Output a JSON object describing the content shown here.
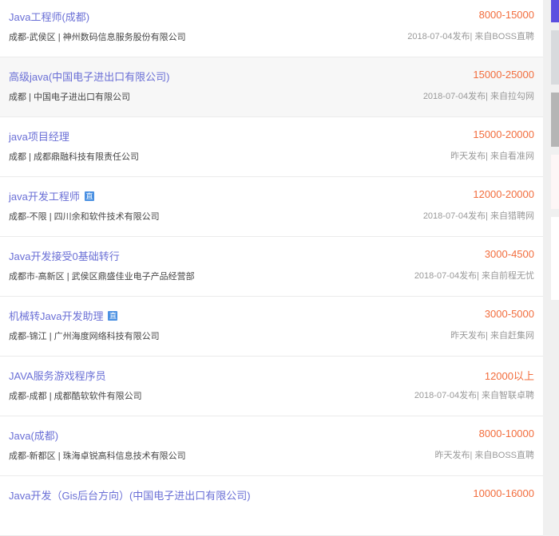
{
  "jobs": [
    {
      "title": "Java工程师(成都)",
      "badge": "",
      "location": "成都-武侯区 | ",
      "company": "神州数码信息服务股份有限公司",
      "salary": "8000-15000",
      "posted": "2018-07-04发布| 来自BOSS直聘"
    },
    {
      "title": "高级java(中国电子进出口有限公司)",
      "badge": "",
      "location": "成都 | ",
      "company": "中国电子进出口有限公司",
      "salary": "15000-25000",
      "posted": "2018-07-04发布| 来自拉勾网"
    },
    {
      "title": "java项目经理",
      "badge": "",
      "location": "成都 | ",
      "company": "成都鼎融科技有限责任公司",
      "salary": "15000-20000",
      "posted": "昨天发布| 来自看准网"
    },
    {
      "title": "java开发工程师",
      "badge": "直",
      "location": "成都-不限 | ",
      "company": "四川余和软件技术有限公司",
      "salary": "12000-20000",
      "posted": "2018-07-04发布| 来自猎聘网"
    },
    {
      "title": "Java开发接受0基础转行",
      "badge": "",
      "location": "成都市-高新区 | ",
      "company": "武侯区鼎盛佳业电子产品经营部",
      "salary": "3000-4500",
      "posted": "2018-07-04发布| 来自前程无忧"
    },
    {
      "title": "机械转Java开发助理",
      "badge": "直",
      "location": "成都-锦江 | ",
      "company": "广州海度网络科技有限公司",
      "salary": "3000-5000",
      "posted": "昨天发布| 来自赶集网"
    },
    {
      "title": "JAVA服务游戏程序员",
      "badge": "",
      "location": "成都-成都 | ",
      "company": "成都酷软软件有限公司",
      "salary": "12000以上",
      "posted": "2018-07-04发布| 来自智联卓聘"
    },
    {
      "title": "Java(成都)",
      "badge": "",
      "location": "成都-新都区 | ",
      "company": "珠海卓锐高科信息技术有限公司",
      "salary": "8000-10000",
      "posted": "昨天发布| 来自BOSS直聘"
    },
    {
      "title": "Java开发（Gis后台方向）(中国电子进出口有限公司)",
      "badge": "",
      "location": "",
      "company": "",
      "salary": "10000-16000",
      "posted": ""
    }
  ],
  "colors": {
    "title": "#6a6fd6",
    "salary": "#f26d3d",
    "accent": "#5b4fe0"
  }
}
